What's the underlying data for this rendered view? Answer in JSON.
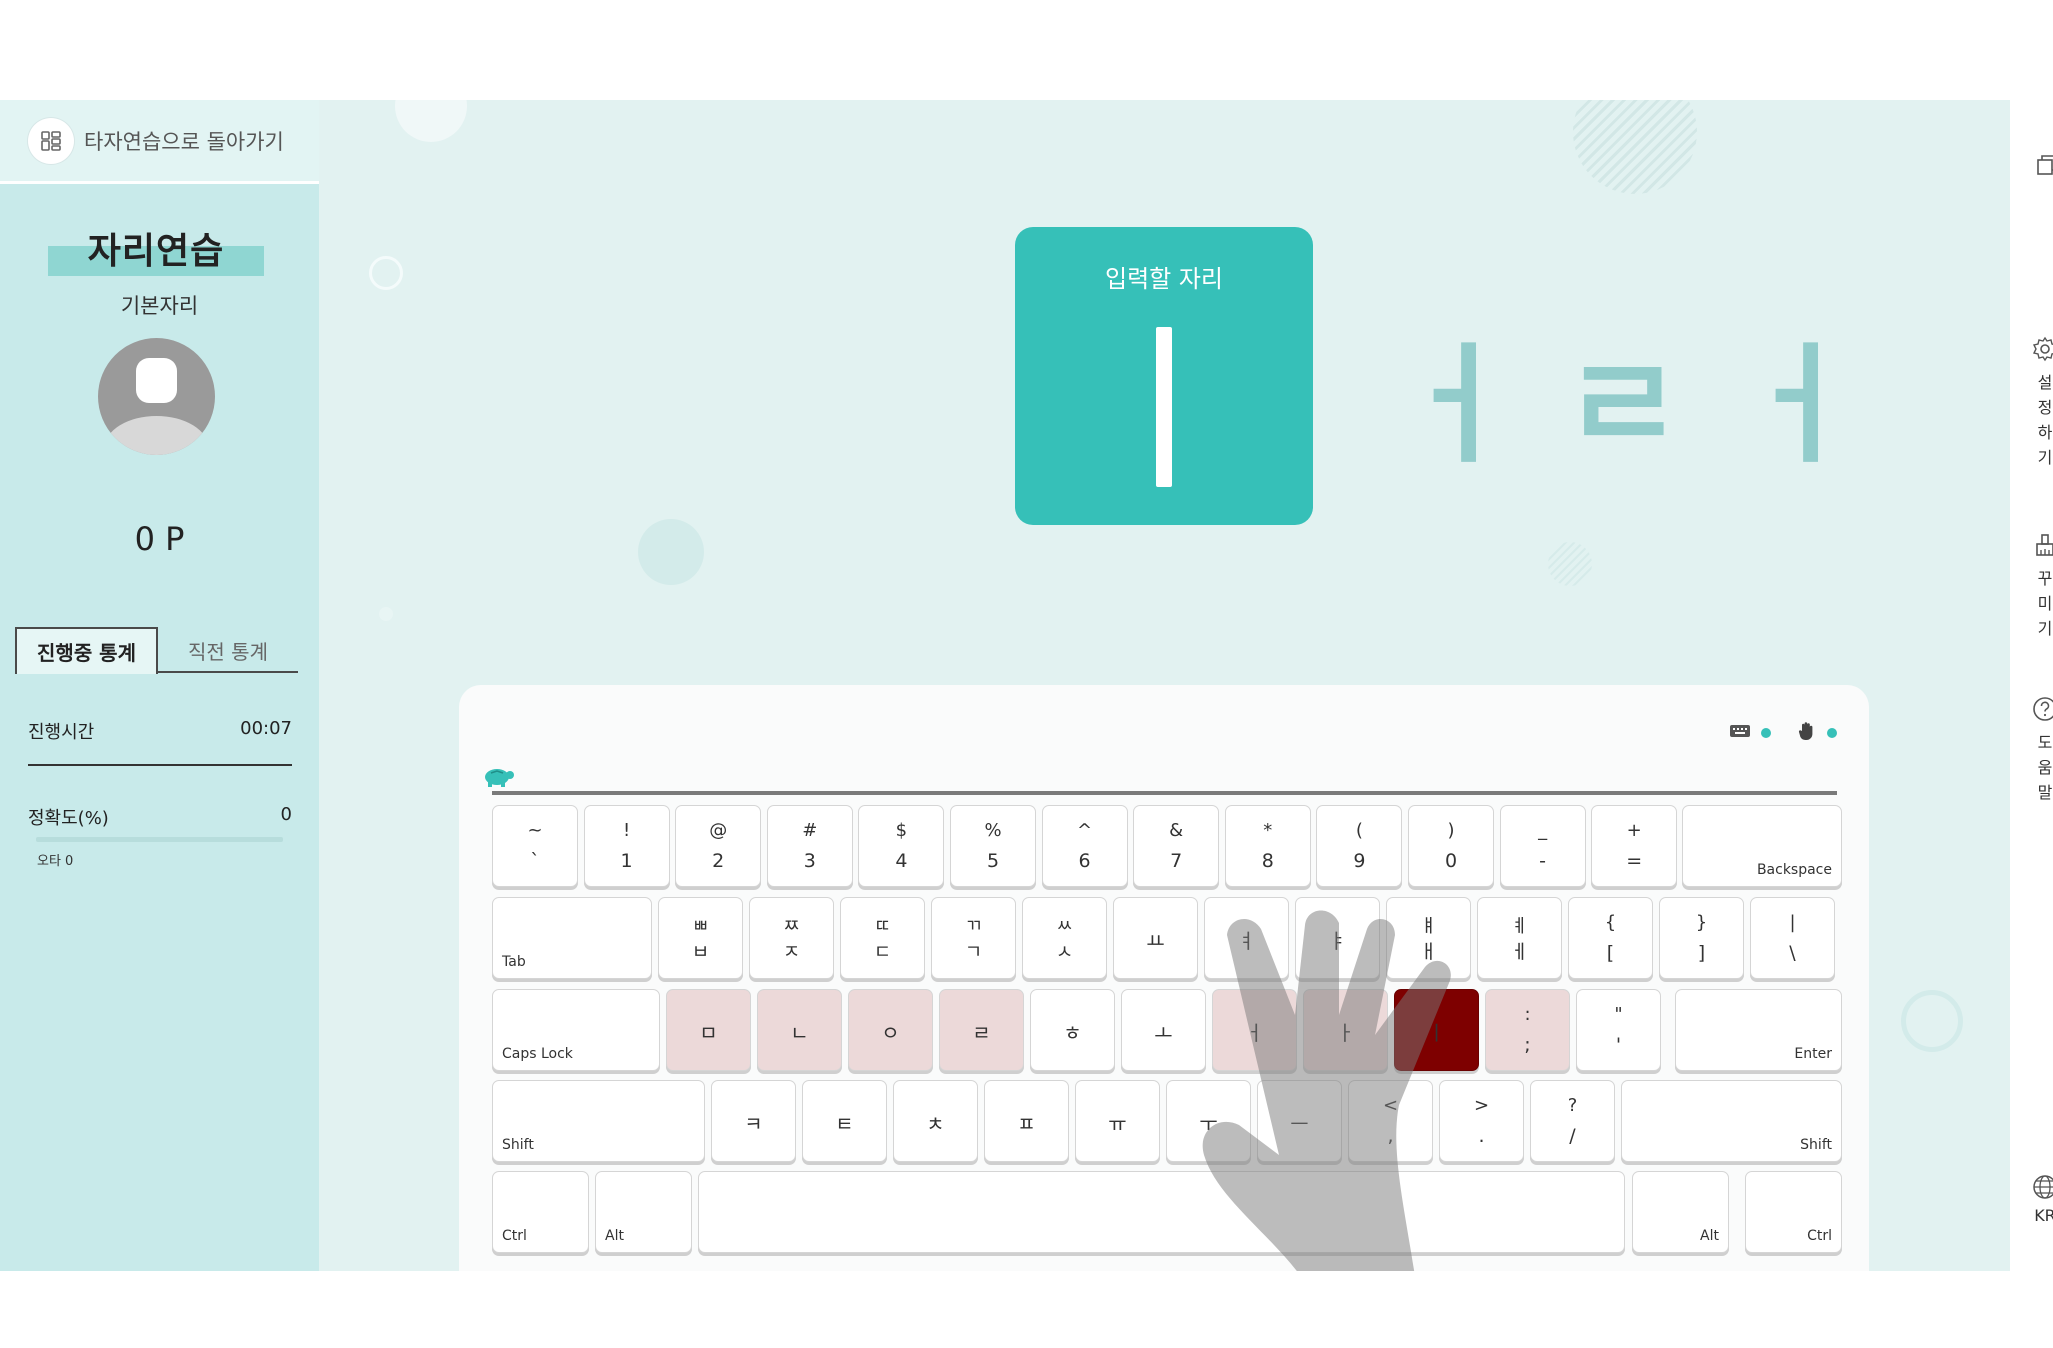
{
  "sidebar": {
    "back_label": "타자연습으로 돌아가기",
    "title": "자리연습",
    "subtitle": "기본자리",
    "points": "0 P",
    "tabs": [
      {
        "label": "진행중 통계",
        "active": true
      },
      {
        "label": "직전 통계",
        "active": false
      }
    ],
    "stats": {
      "time_label": "진행시간",
      "time_value": "00:07",
      "accuracy_label": "정확도(%)",
      "accuracy_value": "0",
      "typo_label": "오타 0"
    }
  },
  "main": {
    "target_label": "입력할 자리",
    "target_char": "ㅣ",
    "next_chars": [
      "ㅓ",
      "ㄹ",
      "ㅓ"
    ]
  },
  "keyboard": {
    "row1": [
      {
        "top": "~",
        "bot": "`"
      },
      {
        "top": "!",
        "bot": "1"
      },
      {
        "top": "@",
        "bot": "2"
      },
      {
        "top": "#",
        "bot": "3"
      },
      {
        "top": "$",
        "bot": "4"
      },
      {
        "top": "%",
        "bot": "5"
      },
      {
        "top": "^",
        "bot": "6"
      },
      {
        "top": "&",
        "bot": "7"
      },
      {
        "top": "*",
        "bot": "8"
      },
      {
        "top": "(",
        "bot": "9"
      },
      {
        "top": ")",
        "bot": "0"
      },
      {
        "top": "_",
        "bot": "-"
      },
      {
        "top": "+",
        "bot": "="
      }
    ],
    "backspace": "Backspace",
    "tab": "Tab",
    "row2": [
      {
        "top": "ㅃ",
        "bot": "ㅂ"
      },
      {
        "top": "ㅉ",
        "bot": "ㅈ"
      },
      {
        "top": "ㄸ",
        "bot": "ㄷ"
      },
      {
        "top": "ㄲ",
        "bot": "ㄱ"
      },
      {
        "top": "ㅆ",
        "bot": "ㅅ"
      },
      {
        "mid": "ㅛ"
      },
      {
        "mid": "ㅕ"
      },
      {
        "mid": "ㅑ"
      },
      {
        "top": "ㅒ",
        "bot": "ㅐ"
      },
      {
        "top": "ㅖ",
        "bot": "ㅔ"
      },
      {
        "top": "{",
        "bot": "["
      },
      {
        "top": "}",
        "bot": "]"
      },
      {
        "top": "|",
        "bot": "\\"
      }
    ],
    "capslock": "Caps Lock",
    "row3": [
      {
        "mid": "ㅁ"
      },
      {
        "mid": "ㄴ"
      },
      {
        "mid": "ㅇ"
      },
      {
        "mid": "ㄹ"
      },
      {
        "mid": "ㅎ"
      },
      {
        "mid": "ㅗ"
      },
      {
        "mid": "ㅓ"
      },
      {
        "mid": "ㅏ"
      },
      {
        "mid": "ㅣ"
      },
      {
        "top": ":",
        "bot": ";"
      },
      {
        "top": "\"",
        "bot": "'"
      }
    ],
    "enter": "Enter",
    "shift": "Shift",
    "row4": [
      {
        "mid": "ㅋ"
      },
      {
        "mid": "ㅌ"
      },
      {
        "mid": "ㅊ"
      },
      {
        "mid": "ㅍ"
      },
      {
        "mid": "ㅠ"
      },
      {
        "mid": "ㅜ"
      },
      {
        "mid": "ㅡ"
      },
      {
        "top": "<",
        "bot": ","
      },
      {
        "top": ">",
        "bot": "."
      },
      {
        "top": "?",
        "bot": "/"
      }
    ],
    "ctrl": "Ctrl",
    "alt": "Alt"
  },
  "rail": {
    "settings": [
      "설",
      "정",
      "하",
      "기"
    ],
    "decorate": [
      "꾸",
      "미",
      "기"
    ],
    "help": [
      "도",
      "움",
      "말"
    ],
    "lang": "KR"
  },
  "colors": {
    "accent": "#36c0b8",
    "home_key": "#ecd9d9",
    "target_key": "#7e0000",
    "sidebar_bg": "#c8eaea",
    "main_bg": "#e2f2f1"
  }
}
